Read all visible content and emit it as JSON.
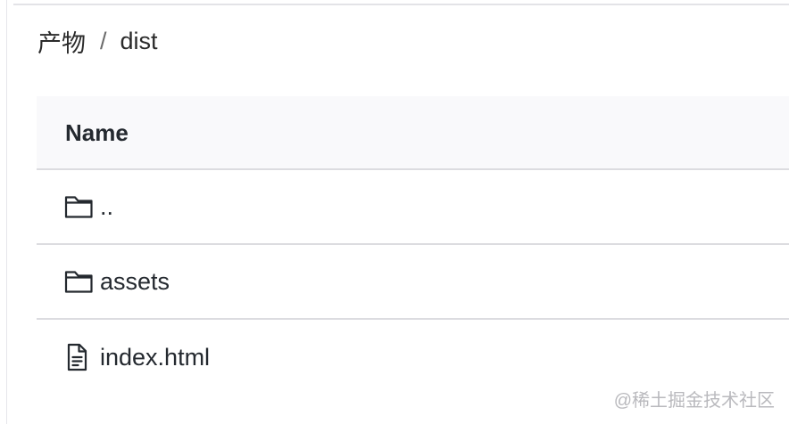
{
  "breadcrumb": {
    "parent": "产物",
    "separator": "/",
    "current": "dist"
  },
  "table": {
    "header_name": "Name",
    "rows": [
      {
        "icon": "folder-icon",
        "name": ".."
      },
      {
        "icon": "folder-icon",
        "name": "assets"
      },
      {
        "icon": "file-icon",
        "name": "index.html"
      }
    ]
  },
  "watermark": "@稀土掘金技术社区"
}
